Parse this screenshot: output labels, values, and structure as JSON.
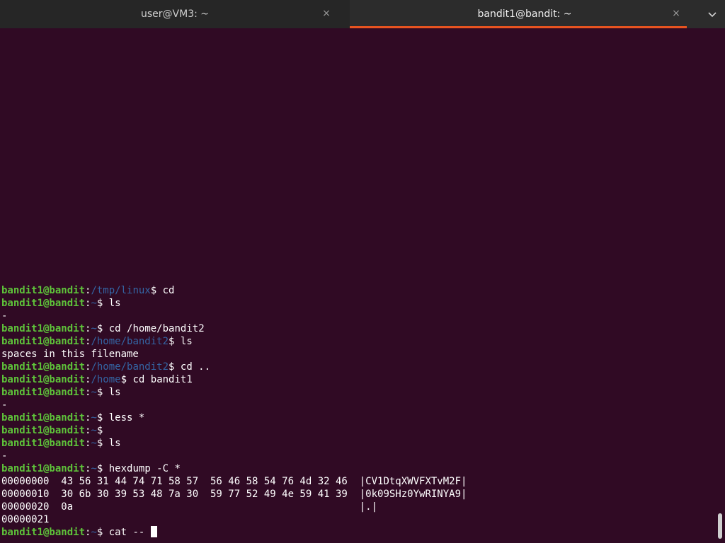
{
  "tabs": [
    {
      "title": "user@VM3: ~",
      "close_icon": "×",
      "active": false
    },
    {
      "title": "bandit1@bandit: ~",
      "close_icon": "×",
      "active": true
    }
  ],
  "tab_menu_icon": "chevron-down",
  "tab_menu_glyph": "⌄",
  "accent_color": "#e95420",
  "prompt_color": "#5ec33a",
  "path_color": "#3465a4",
  "background_color": "#300a24",
  "terminal": {
    "lines": [
      {
        "user": "bandit1@bandit",
        "sep": ":",
        "path": "/tmp/linux",
        "sym": "$",
        "cmd": " cd"
      },
      {
        "user": "bandit1@bandit",
        "sep": ":",
        "path": "~",
        "sym": "$",
        "cmd": " ls"
      },
      {
        "text": "-"
      },
      {
        "user": "bandit1@bandit",
        "sep": ":",
        "path": "~",
        "sym": "$",
        "cmd": " cd /home/bandit2"
      },
      {
        "user": "bandit1@bandit",
        "sep": ":",
        "path": "/home/bandit2",
        "sym": "$",
        "cmd": " ls"
      },
      {
        "text": "spaces in this filename"
      },
      {
        "user": "bandit1@bandit",
        "sep": ":",
        "path": "/home/bandit2",
        "sym": "$",
        "cmd": " cd .."
      },
      {
        "user": "bandit1@bandit",
        "sep": ":",
        "path": "/home",
        "sym": "$",
        "cmd": " cd bandit1"
      },
      {
        "user": "bandit1@bandit",
        "sep": ":",
        "path": "~",
        "sym": "$",
        "cmd": " ls"
      },
      {
        "text": "-"
      },
      {
        "user": "bandit1@bandit",
        "sep": ":",
        "path": "~",
        "sym": "$",
        "cmd": " less *"
      },
      {
        "user": "bandit1@bandit",
        "sep": ":",
        "path": "~",
        "sym": "$",
        "cmd": ""
      },
      {
        "user": "bandit1@bandit",
        "sep": ":",
        "path": "~",
        "sym": "$",
        "cmd": " ls"
      },
      {
        "text": "-"
      },
      {
        "user": "bandit1@bandit",
        "sep": ":",
        "path": "~",
        "sym": "$",
        "cmd": " hexdump -C *"
      },
      {
        "text": "00000000  43 56 31 44 74 71 58 57  56 46 58 54 76 4d 32 46  |CV1DtqXWVFXTvM2F|"
      },
      {
        "text": "00000010  30 6b 30 39 53 48 7a 30  59 77 52 49 4e 59 41 39  |0k09SHz0YwRINYA9|"
      },
      {
        "text": "00000020  0a                                                |.|"
      },
      {
        "text": "00000021"
      },
      {
        "user": "bandit1@bandit",
        "sep": ":",
        "path": "~",
        "sym": "$",
        "cmd": " cat -- ",
        "cursor": true
      }
    ]
  }
}
